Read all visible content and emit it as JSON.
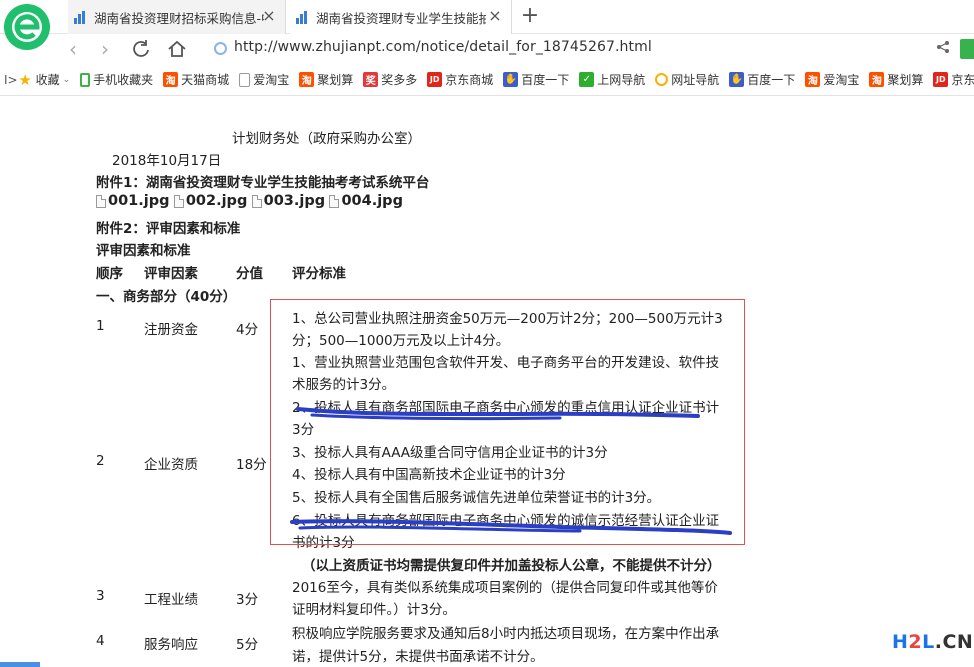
{
  "browser": {
    "tabs": [
      {
        "title": "湖南省投资理财招标采购信息-中",
        "active": false
      },
      {
        "title": "湖南省投资理财专业学生技能抽考",
        "active": true
      }
    ],
    "close_glyph": "×",
    "new_tab_glyph": "+",
    "url": "http://www.zhujianpt.com/notice/detail_for_18745267.html"
  },
  "bookmarks": [
    {
      "label": "收藏",
      "icon": "star-icon"
    },
    {
      "label": "手机收藏夹",
      "icon": "phone-icon"
    },
    {
      "label": "天猫商城",
      "icon": "tao-icon"
    },
    {
      "label": "爱淘宝",
      "icon": "page-icon"
    },
    {
      "label": "聚划算",
      "icon": "tao-icon"
    },
    {
      "label": "奖多多",
      "icon": "jiang-icon"
    },
    {
      "label": "京东商城",
      "icon": "jd-icon"
    },
    {
      "label": "百度一下",
      "icon": "baidu-icon"
    },
    {
      "label": "上网导航",
      "icon": "hao-icon"
    },
    {
      "label": "网址导航",
      "icon": "nav-icon"
    },
    {
      "label": "百度一下",
      "icon": "baidu-icon"
    },
    {
      "label": "爱淘宝",
      "icon": "tao-icon"
    },
    {
      "label": "聚划算",
      "icon": "tao-icon"
    },
    {
      "label": "京东",
      "icon": "jd-icon"
    }
  ],
  "doc": {
    "org": "计划财务处（政府采购办公室）",
    "date": "2018年10月17日",
    "attachment1_title": "附件1：湖南省投资理财专业学生技能抽考考试系统平台",
    "files": [
      "001.jpg",
      "002.jpg",
      "003.jpg",
      "004.jpg"
    ],
    "attachment2_title": "附件2：评审因素和标准",
    "section_title": "评审因素和标准",
    "headers": {
      "no": "顺序",
      "factor": "评审因素",
      "score": "分值",
      "criteria": "评分标准"
    },
    "business_section": "一、商务部分（40分）",
    "rows": [
      {
        "no": "1",
        "factor": "注册资金",
        "score": "4分"
      },
      {
        "no": "2",
        "factor": "企业资质",
        "score": "18分"
      },
      {
        "no": "3",
        "factor": "工程业绩",
        "score": "3分"
      },
      {
        "no": "4",
        "factor": "服务响应",
        "score": "5分"
      }
    ],
    "criteria_lines": [
      "1、总公司营业执照注册资金50万元—200万计2分；200—500万元计3",
      "分；500—1000万元及以上计4分。",
      "1、营业执照营业范围包含软件开发、电子商务平台的开发建设、软件技",
      "术服务的计3分。",
      "2、投标人具有商务部国际电子商务中心颁发的重点信用认证企业证书计",
      "3分",
      "3、投标人具有AAA级重合同守信用企业证书的计3分",
      "4、投标人具有中国高新技术企业证书的计3分",
      "5、投标人具有全国售后服务诚信先进单位荣誉证书的计3分。",
      "6、投标人具有商务部国际电子商务中心颁发的诚信示范经营认证企业证",
      "书的计3分"
    ],
    "note": "（以上资质证书均需提供复印件并加盖投标人公章，不能提供不计分）",
    "performance_lines": [
      "2016至今，具有类似系统集成项目案例的（提供合同复印件或其他等价",
      "证明材料复印件。）计3分。"
    ],
    "response_lines": [
      "积极响应学院服务要求及通知后8小时内抵达项目现场，在方案中作出承",
      "诺，提供计5分，未提供书面承诺不计分。"
    ]
  },
  "watermark": {
    "h": "H",
    "two": "2",
    "l": "L",
    "cn": ".CN"
  },
  "colors": {
    "accent": "#1fbf6e",
    "highlight_box": "#d9534f",
    "scribble": "#2b3fc4"
  }
}
